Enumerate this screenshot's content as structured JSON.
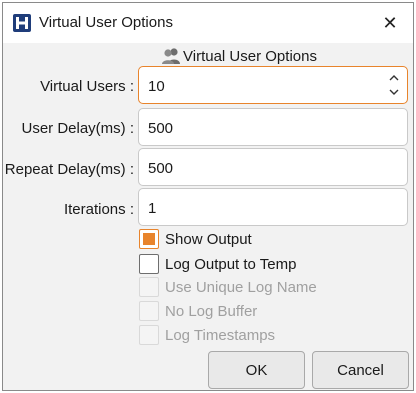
{
  "window": {
    "title": "Virtual User Options"
  },
  "header": {
    "title": "Virtual User Options"
  },
  "fields": {
    "virtual_users": {
      "label": "Virtual Users :",
      "value": "10"
    },
    "user_delay": {
      "label": "User Delay(ms) :",
      "value": "500"
    },
    "repeat_delay": {
      "label": "Repeat Delay(ms) :",
      "value": "500"
    },
    "iterations": {
      "label": "Iterations :",
      "value": "1"
    }
  },
  "options": [
    {
      "label": "Show Output",
      "checked": true,
      "enabled": true
    },
    {
      "label": "Log Output to Temp",
      "checked": false,
      "enabled": true
    },
    {
      "label": "Use Unique Log Name",
      "checked": false,
      "enabled": false
    },
    {
      "label": "No Log Buffer",
      "checked": false,
      "enabled": false
    },
    {
      "label": "Log Timestamps",
      "checked": false,
      "enabled": false
    }
  ],
  "buttons": {
    "ok": "OK",
    "cancel": "Cancel"
  },
  "colors": {
    "accent": "#e8842c",
    "app_icon": "#1f3d7a"
  }
}
